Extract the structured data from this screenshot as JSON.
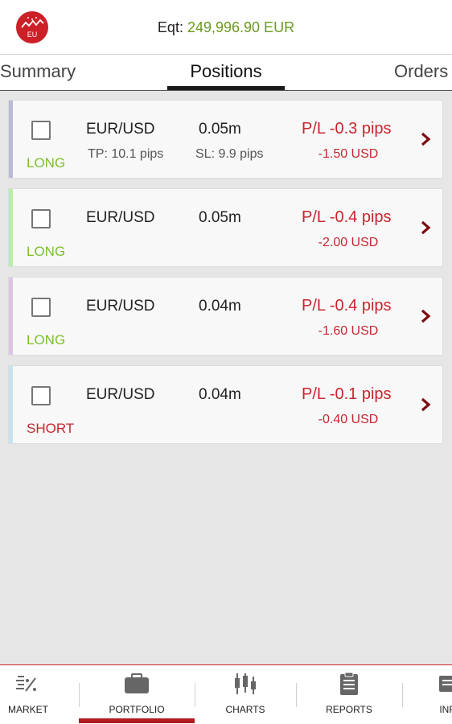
{
  "header": {
    "logo_text": "EU",
    "equity_label": "Eqt:",
    "equity_value": "249,996.90 EUR"
  },
  "tabs": [
    {
      "label": "Summary"
    },
    {
      "label": "Positions",
      "active": true
    },
    {
      "label": "Orders"
    }
  ],
  "positions": [
    {
      "symbol": "EUR/USD",
      "size": "0.05m",
      "direction": "LONG",
      "tp": "TP: 10.1 pips",
      "sl": "SL: 9.9 pips",
      "pl_pips": "P/L -0.3 pips",
      "pl_amount": "-1.50 USD",
      "accent_color": "#b9bbd6"
    },
    {
      "symbol": "EUR/USD",
      "size": "0.05m",
      "direction": "LONG",
      "pl_pips": "P/L -0.4 pips",
      "pl_amount": "-2.00 USD",
      "accent_color": "#b6f0a6"
    },
    {
      "symbol": "EUR/USD",
      "size": "0.04m",
      "direction": "LONG",
      "pl_pips": "P/L -0.4 pips",
      "pl_amount": "-1.60 USD",
      "accent_color": "#dcc6e4"
    },
    {
      "symbol": "EUR/USD",
      "size": "0.04m",
      "direction": "SHORT",
      "pl_pips": "P/L -0.1 pips",
      "pl_amount": "-0.40 USD",
      "accent_color": "#c6e4ef"
    }
  ],
  "bottom_nav": [
    {
      "label": "MARKET",
      "icon": "market-percent-icon"
    },
    {
      "label": "PORTFOLIO",
      "icon": "briefcase-icon",
      "active": true
    },
    {
      "label": "CHARTS",
      "icon": "candlestick-icon"
    },
    {
      "label": "REPORTS",
      "icon": "clipboard-icon"
    },
    {
      "label": "INF",
      "icon": "info-icon"
    }
  ],
  "colors": {
    "brand_red": "#cc1f27",
    "equity_green": "#6a9a1f",
    "long_green": "#7bbf2a",
    "loss_red": "#c8262d",
    "chevron_dark_red": "#7a0e12"
  }
}
